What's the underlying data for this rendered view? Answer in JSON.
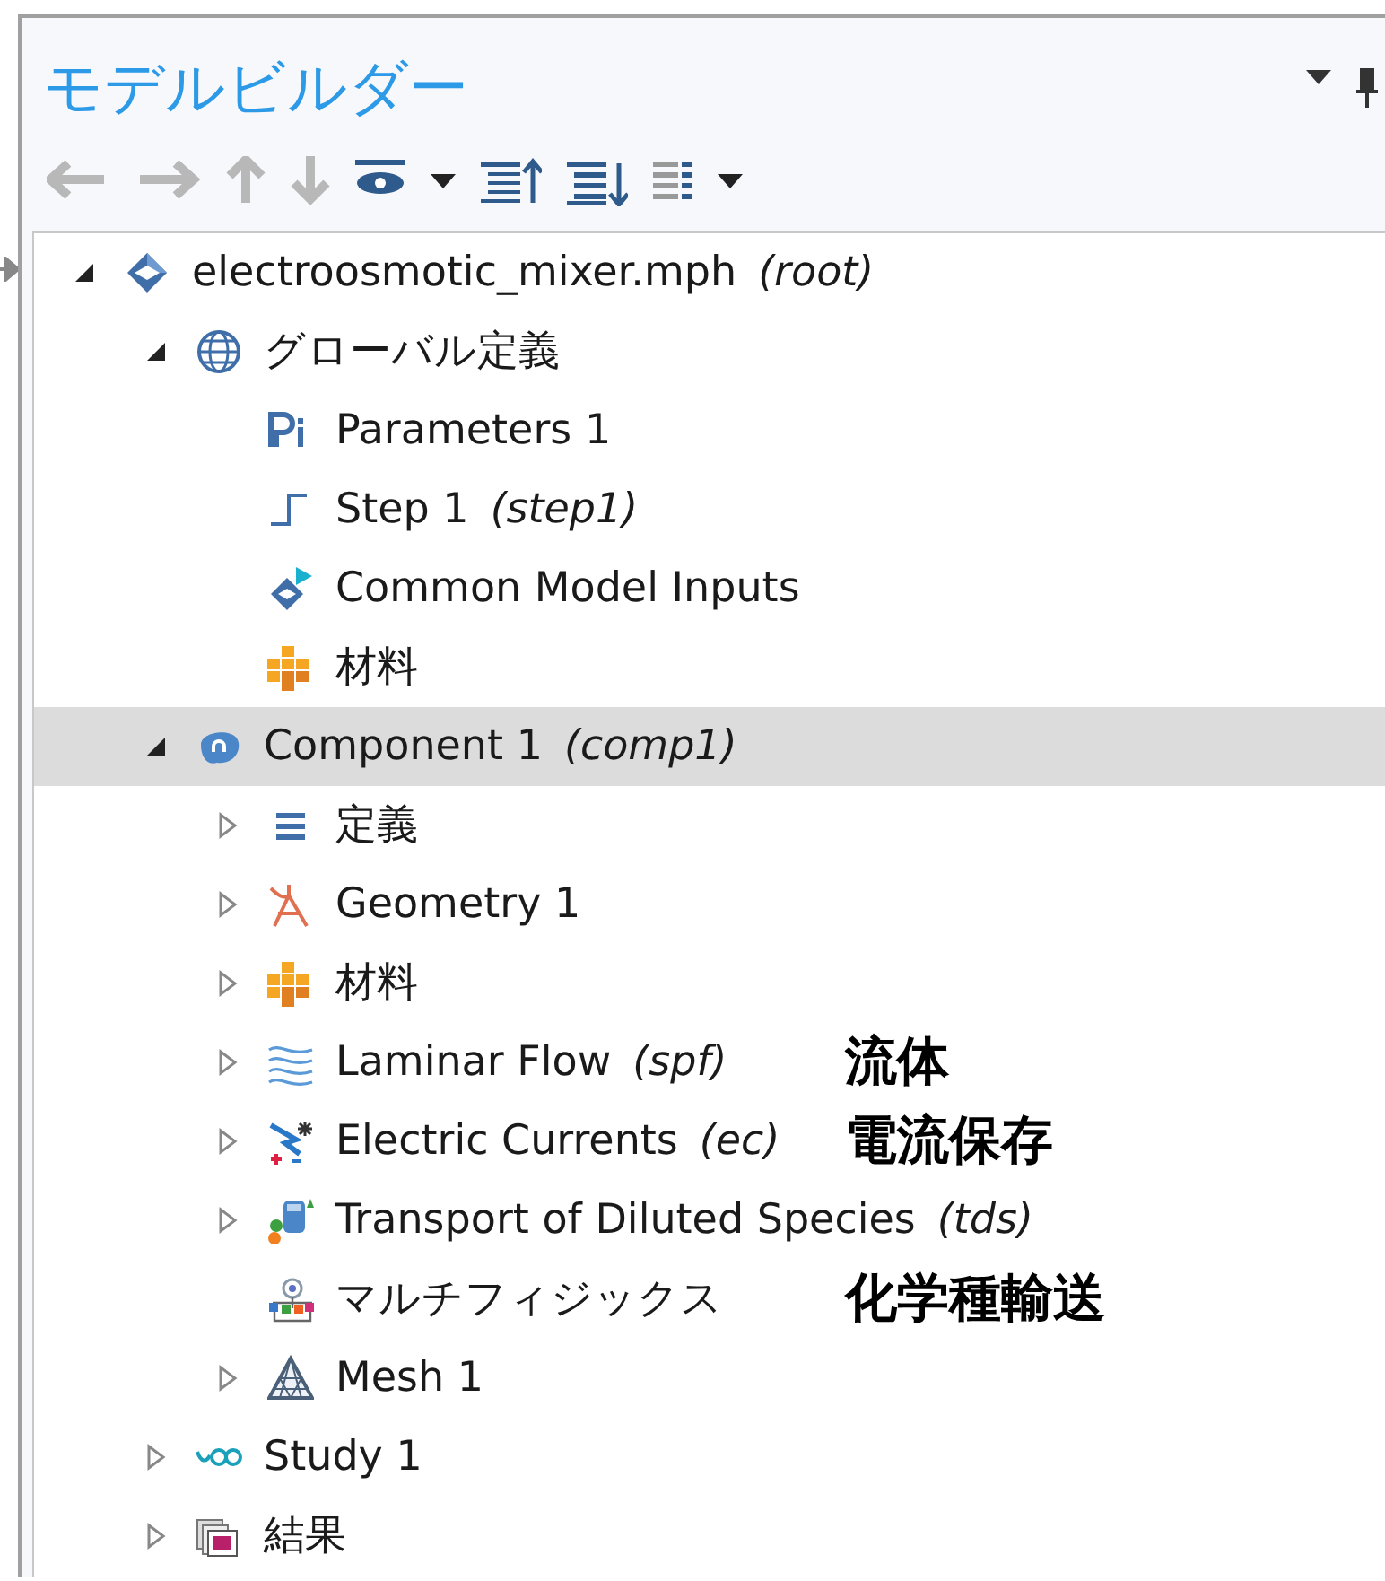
{
  "panel": {
    "title": "モデルビルダー"
  },
  "toolbar": [
    {
      "kind": "back",
      "disabled": true
    },
    {
      "kind": "forward",
      "disabled": true
    },
    {
      "kind": "up",
      "disabled": true
    },
    {
      "kind": "down",
      "disabled": true
    },
    {
      "kind": "eye",
      "disabled": false
    },
    {
      "kind": "caret",
      "disabled": false
    },
    {
      "kind": "collapse",
      "disabled": false
    },
    {
      "kind": "expand",
      "disabled": false
    },
    {
      "kind": "list",
      "disabled": false
    },
    {
      "kind": "caret",
      "disabled": false
    }
  ],
  "tree": [
    {
      "label": "electroosmotic_mixer.mph",
      "tag": "(root)",
      "kind": "model",
      "expanded": true,
      "selected": false,
      "children": [
        {
          "label": "グローバル定義",
          "kind": "globe",
          "expanded": true,
          "selected": false,
          "children": [
            {
              "label": "Parameters 1",
              "kind": "params",
              "selected": false
            },
            {
              "label": "Step 1",
              "tag": "(step1)",
              "kind": "step",
              "selected": false
            },
            {
              "label": "Common Model Inputs",
              "kind": "inputs",
              "selected": false
            },
            {
              "label": "材料",
              "kind": "materials",
              "selected": false
            }
          ]
        },
        {
          "label": "Component 1",
          "tag": "(comp1)",
          "kind": "component",
          "expanded": true,
          "selected": true,
          "children": [
            {
              "label": "定義",
              "kind": "definitions",
              "expanded": false,
              "selected": false
            },
            {
              "label": "Geometry 1",
              "kind": "geometry",
              "expanded": false,
              "selected": false
            },
            {
              "label": "材料",
              "kind": "materials",
              "expanded": false,
              "selected": false
            },
            {
              "label": "Laminar Flow",
              "tag": "(spf)",
              "kind": "flow",
              "expanded": false,
              "selected": false,
              "annotation": "流体"
            },
            {
              "label": "Electric Currents",
              "tag": "(ec)",
              "kind": "electric",
              "expanded": false,
              "selected": false,
              "annotation": "電流保存"
            },
            {
              "label": "Transport of Diluted Species",
              "tag": "(tds)",
              "kind": "transport",
              "expanded": false,
              "selected": false
            },
            {
              "label": "マルチフィジックス",
              "kind": "multiphysics",
              "selected": false,
              "annotation": "化学種輸送"
            },
            {
              "label": "Mesh 1",
              "kind": "mesh",
              "expanded": false,
              "selected": false
            }
          ]
        },
        {
          "label": "Study 1",
          "kind": "study",
          "expanded": false,
          "selected": false
        },
        {
          "label": "結果",
          "kind": "results",
          "expanded": false,
          "selected": false
        }
      ]
    }
  ]
}
